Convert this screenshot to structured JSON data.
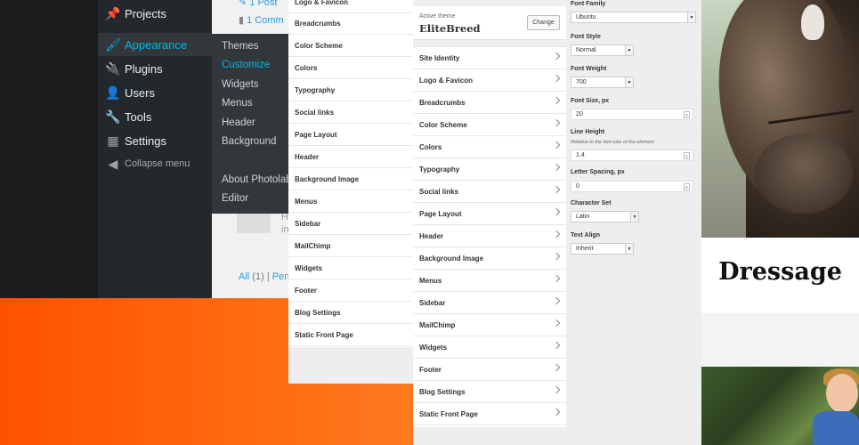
{
  "wp_sidebar": {
    "items": [
      {
        "label": "Projects",
        "icon": "pin-icon"
      },
      {
        "label": "Appearance",
        "icon": "brush-icon",
        "active": true
      },
      {
        "label": "Plugins",
        "icon": "plug-icon"
      },
      {
        "label": "Users",
        "icon": "user-icon"
      },
      {
        "label": "Tools",
        "icon": "wrench-icon"
      },
      {
        "label": "Settings",
        "icon": "settings-icon"
      },
      {
        "label": "Collapse menu",
        "icon": "collapse-icon"
      }
    ]
  },
  "wp_submenu": {
    "items": [
      "Themes",
      "Customize",
      "Widgets",
      "Menus",
      "Header",
      "Background",
      "About Photolab",
      "Editor"
    ],
    "current": "Customize"
  },
  "wp_posts": {
    "posts_link": "1 Post",
    "comments_link": "1 Comm",
    "comment_h1": "H",
    "comment_h2": "in",
    "filter_all": "All",
    "filter_count": "(1)",
    "filter_next": "Pen"
  },
  "mid_menu": {
    "items": [
      "Logo & Favicon",
      "Breadcrumbs",
      "Color Scheme",
      "Colors",
      "Typography",
      "Social links",
      "Page Layout",
      "Header",
      "Background Image",
      "Menus",
      "Sidebar",
      "MailChimp",
      "Widgets",
      "Footer",
      "Blog Settings",
      "Static Front Page"
    ]
  },
  "customizer": {
    "active_theme_label": "Active theme",
    "theme_name": "EliteBreed",
    "change_label": "Change",
    "sections": [
      "Site Identity",
      "Logo & Favicon",
      "Breadcrumbs",
      "Color Scheme",
      "Colors",
      "Typography",
      "Social links",
      "Page Layout",
      "Header",
      "Background Image",
      "Menus",
      "Sidebar",
      "MailChimp",
      "Widgets",
      "Footer",
      "Blog Settings",
      "Static Front Page"
    ]
  },
  "typography": {
    "font_family_label": "Font Family",
    "font_family_value": "Ubuntu",
    "font_style_label": "Font Style",
    "font_style_value": "Normal",
    "font_weight_label": "Font Weight",
    "font_weight_value": "700",
    "font_size_label": "Font Size, px",
    "font_size_value": "20",
    "line_height_label": "Line Height",
    "line_height_hint": "Relative to the font-size of the element",
    "line_height_value": "1.4",
    "letter_spacing_label": "Letter Spacing, px",
    "letter_spacing_value": "0",
    "character_set_label": "Character Set",
    "character_set_value": "Latin",
    "text_align_label": "Text Align",
    "text_align_value": "Inherit"
  },
  "preview": {
    "title": "Dressage"
  },
  "colors": {
    "wp_sidebar_bg": "#23282d",
    "wp_accent": "#00b9eb",
    "orange": "#ff5a00"
  }
}
